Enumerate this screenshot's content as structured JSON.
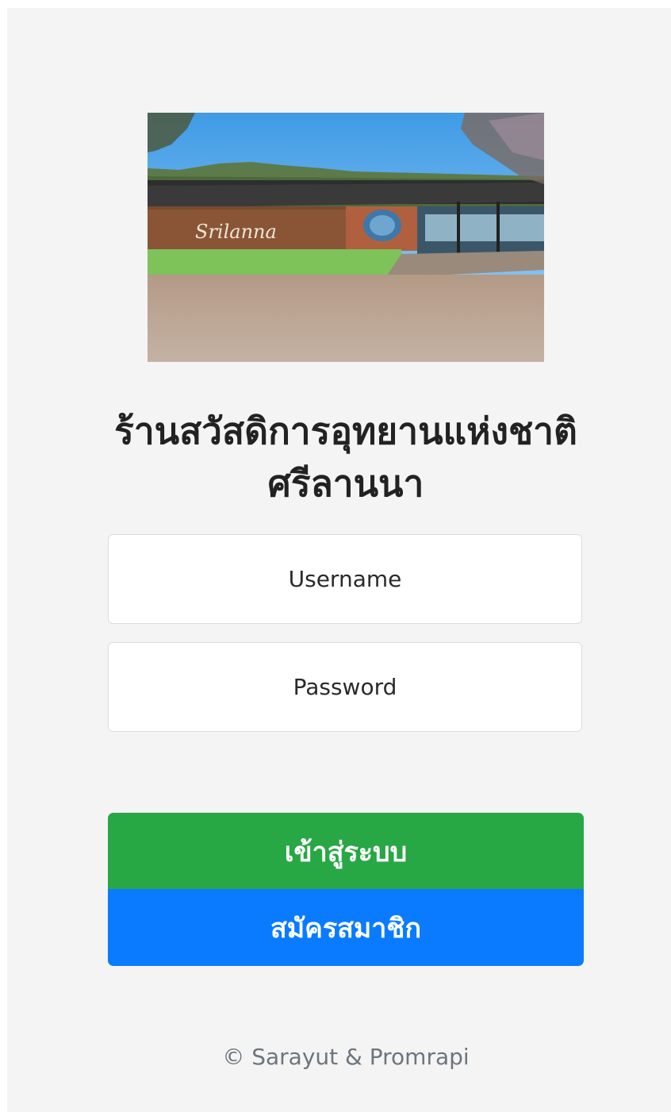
{
  "hero_image": {
    "icon": "landscape-photo"
  },
  "header": {
    "title": "ร้านสวัสดิการอุทยานแห่งชาติศรีลานนา"
  },
  "form": {
    "username_placeholder": "Username",
    "password_placeholder": "Password",
    "login_label": "เข้าสู่ระบบ",
    "register_label": "สมัครสมาชิก"
  },
  "footer": {
    "copyright": "© Sarayut & Promrapi"
  },
  "colors": {
    "login": "#28a745",
    "register": "#0a7bff",
    "background": "#f4f4f4"
  }
}
